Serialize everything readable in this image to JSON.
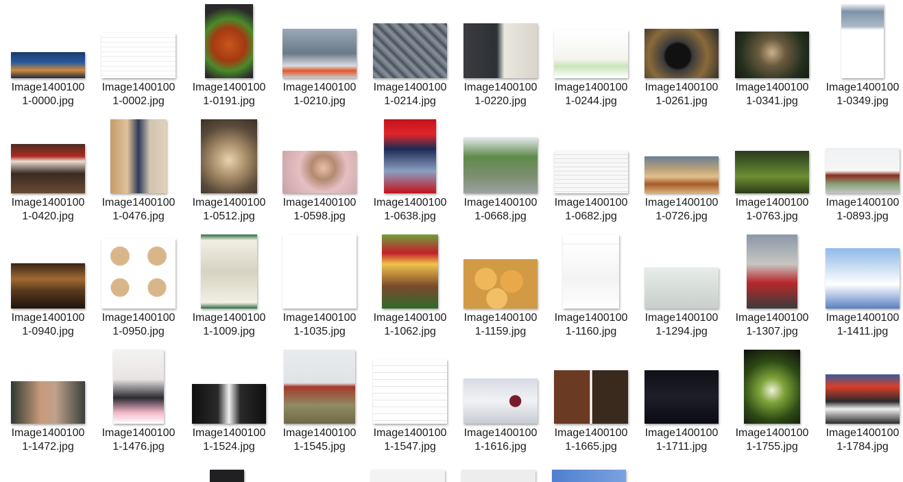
{
  "files": [
    {
      "line1": "Image1400100",
      "line2": "1-0000.jpg",
      "icon": "night-city-skyline-thumbnail",
      "bg": "linear-gradient(180deg,#1b3a6b 0%,#2a5a9c 40%,#d08a3a 70%,#1b2a44 100%)"
    },
    {
      "line1": "Image1400100",
      "line2": "1-0002.jpg",
      "icon": "document-table-thumbnail",
      "bg": "repeating-linear-gradient(180deg,#ffffff 0px,#ffffff 6px,#d8d8d8 7px)"
    },
    {
      "line1": "Image1400100",
      "line2": "1-0191.jpg",
      "icon": "stir-fry-dish-thumbnail",
      "bg": "radial-gradient(circle at 50% 55%,#c8551d 0%,#a33a12 35%,#4b8a2a 55%,#2a2a2a 80%)"
    },
    {
      "line1": "Image1400100",
      "line2": "1-0210.jpg",
      "icon": "snow-street-workers-thumbnail",
      "bg": "linear-gradient(180deg,#9aa9b8 0%,#6b7a88 50%,#d8dde2 75%,#e2572b 85%,#c9ced4 100%)"
    },
    {
      "line1": "Image1400100",
      "line2": "1-0214.jpg",
      "icon": "aerial-rooftops-thumbnail",
      "bg": "repeating-linear-gradient(45deg,#5b6470 0px,#8a939d 6px,#3e464f 12px)"
    },
    {
      "line1": "Image1400100",
      "line2": "1-0220.jpg",
      "icon": "man-at-door-thumbnail",
      "bg": "linear-gradient(90deg,#3b3b40 0%,#2c3136 45%,#e9e7df 55%,#d9d4c9 100%)"
    },
    {
      "line1": "Image1400100",
      "line2": "1-0244.jpg",
      "icon": "cartoon-sketch-thumbnail",
      "bg": "linear-gradient(180deg,#ffffff 0%,#f4f4ef 60%,#c9e6b8 75%,#ffffff 100%)"
    },
    {
      "line1": "Image1400100",
      "line2": "1-0261.jpg",
      "icon": "camera-lens-thumbnail",
      "bg": "radial-gradient(circle at 45% 55%,#111 0%,#111 25%,#3b3b3b 30%,#8a6a3a 60%,#2a2a2a 100%)"
    },
    {
      "line1": "Image1400100",
      "line2": "1-0341.jpg",
      "icon": "old-man-portrait-thumbnail",
      "bg": "radial-gradient(circle at 50% 45%,#c9b08a 0%,#6a5a3e 30%,#26301f 70%,#141a12 100%)"
    },
    {
      "line1": "Image1400100",
      "line2": "1-0349.jpg",
      "icon": "mobile-app-screenshot-thumbnail",
      "bg": "linear-gradient(180deg,#f2f2f2 0%,#7f93a8 10%,#a9b8c6 30%,#ffffff 35%,#ffffff 100%)"
    },
    {
      "line1": "Image1400100",
      "line2": "1-0420.jpg",
      "icon": "restaurant-facade-thumbnail",
      "bg": "linear-gradient(180deg,#4a2d22 0%,#b02a20 25%,#e9ddd2 35%,#3a2a22 60%,#6a4a33 100%)"
    },
    {
      "line1": "Image1400100",
      "line2": "1-0476.jpg",
      "icon": "street-fashion-man-thumbnail",
      "bg": "linear-gradient(90deg,#c59b6a 0%,#e1c29a 30%,#2d3a58 50%,#cfc4b1 70%,#e2d2bb 100%)"
    },
    {
      "line1": "Image1400100",
      "line2": "1-0512.jpg",
      "icon": "fantasy-illustration-thumbnail",
      "bg": "radial-gradient(circle at 50% 55%,#e7d3b0 0%,#a88d69 35%,#5a4a3a 70%,#3a2f25 100%)"
    },
    {
      "line1": "Image1400100",
      "line2": "1-0598.jpg",
      "icon": "woman-portrait-thumbnail",
      "bg": "radial-gradient(circle at 55% 40%,#e6c1a8 0%,#b38a71 25%,#e5bfc2 50%,#caa0a6 100%)"
    },
    {
      "line1": "Image1400100",
      "line2": "1-0638.jpg",
      "icon": "police-poster-thumbnail",
      "bg": "linear-gradient(180deg,#c3121a 0%,#e0262b 20%,#1b2a54 40%,#8aa0c2 70%,#c3121a 100%)"
    },
    {
      "line1": "Image1400100",
      "line2": "1-0668.jpg",
      "icon": "tree-parking-thumbnail",
      "bg": "linear-gradient(180deg,#e6ebef 0%,#5f8a4b 35%,#7c8f6f 70%,#9da1a3 100%)"
    },
    {
      "line1": "Image1400100",
      "line2": "1-0682.jpg",
      "icon": "spreadsheet-thumbnail",
      "bg": "repeating-linear-gradient(180deg,#f7f7f7 0px,#f7f7f7 5px,#c9c9c9 6px)"
    },
    {
      "line1": "Image1400100",
      "line2": "1-0726.jpg",
      "icon": "market-food-thumbnail",
      "bg": "linear-gradient(180deg,#6a7f96 0%,#b9a27a 35%,#e2c08b 55%,#a55a2b 75%,#d9b27a 100%)"
    },
    {
      "line1": "Image1400100",
      "line2": "1-0763.jpg",
      "icon": "football-referees-thumbnail",
      "bg": "linear-gradient(180deg,#2b3a1e 0%,#4d6a2a 35%,#6f8f33 60%,#2a3b18 100%)"
    },
    {
      "line1": "Image1400100",
      "line2": "1-0893.jpg",
      "icon": "modern-building-thumbnail",
      "bg": "linear-gradient(180deg,#eef1f3 0%,#f6f6f4 50%,#8a2d22 60%,#8aa27a 80%,#c3c8c4 100%)"
    },
    {
      "line1": "Image1400100",
      "line2": "1-0940.jpg",
      "icon": "bookstore-interior-thumbnail",
      "bg": "linear-gradient(180deg,#3b2516 0%,#a06a30 35%,#5a3a1e 60%,#1f140c 100%)"
    },
    {
      "line1": "Image1400100",
      "line2": "1-0950.jpg",
      "icon": "toilet-posture-diagram-thumbnail",
      "bg": "radial-gradient(circle at 25% 25%,#d9b68a 0 12%,transparent 13%),radial-gradient(circle at 75% 25%,#d9b68a 0 12%,transparent 13%),radial-gradient(circle at 25% 70%,#d9b68a 0 12%,transparent 13%),radial-gradient(circle at 75% 70%,#d9b68a 0 12%,transparent 13%),#ffffff"
    },
    {
      "line1": "Image1400100",
      "line2": "1-1009.jpg",
      "icon": "ink-drawing-poster-thumbnail",
      "bg": "linear-gradient(180deg,#2c6e3e 0%,#f1efe3 8%,#d7d2c1 50%,#f1efe3 92%,#2c6e3e 100%)"
    },
    {
      "line1": "Image1400100",
      "line2": "1-1035.jpg",
      "icon": "cat-line-drawing-thumbnail",
      "bg": "#ffffff"
    },
    {
      "line1": "Image1400100",
      "line2": "1-1062.jpg",
      "icon": "shop-stall-thumbnail",
      "bg": "linear-gradient(180deg,#6f9f3a 0%,#c3202a 25%,#f1c24a 40%,#7a4a2a 70%,#2f6a2a 100%)"
    },
    {
      "line1": "Image1400100",
      "line2": "1-1159.jpg",
      "icon": "sesame-balls-thumbnail",
      "bg": "radial-gradient(circle at 30% 40%,#f0b75a 0 18%,transparent 19%),radial-gradient(circle at 65% 45%,#e9a84a 0 20%,transparent 21%),radial-gradient(circle at 45% 80%,#f2bf66 0 18%,transparent 19%),#d39a45"
    },
    {
      "line1": "Image1400100",
      "line2": "1-1160.jpg",
      "icon": "worksheet-comic-thumbnail",
      "bg": "linear-gradient(180deg,#ffffff 0%,#ffffff 12%,#e8e8e8 13%,#ffffff 14%,#f3f3f3 60%,#ffffff 100%)"
    },
    {
      "line1": "Image1400100",
      "line2": "1-1294.jpg",
      "icon": "menu-paper-thumbnail",
      "bg": "linear-gradient(180deg,#e7ece9 0%,#d7ddd9 50%,#c9cfcb 100%)"
    },
    {
      "line1": "Image1400100",
      "line2": "1-1307.jpg",
      "icon": "girl-red-vest-thumbnail",
      "bg": "linear-gradient(180deg,#8a98a8 0%,#c7c6c2 40%,#b8282a 65%,#3b3b3b 100%)"
    },
    {
      "line1": "Image1400100",
      "line2": "1-1411.jpg",
      "icon": "anime-character-thumbnail",
      "bg": "linear-gradient(180deg,#8fb9e8 0%,#d9e8f6 40%,#ffffff 60%,#5a7fc2 100%)"
    },
    {
      "line1": "Image1400100",
      "line2": "1-1472.jpg",
      "icon": "man-in-car-thumbnail",
      "bg": "linear-gradient(90deg,#2f3a33 0%,#c79b7a 40%,#bfa18b 60%,#3a3f3b 100%)"
    },
    {
      "line1": "Image1400100",
      "line2": "1-1476.jpg",
      "icon": "girl-balloons-thumbnail",
      "bg": "linear-gradient(180deg,#f3f3f3 0%,#e9e4e2 40%,#2a2a33 65%,#f2b7c8 85%,#ffffff 100%)"
    },
    {
      "line1": "Image1400100",
      "line2": "1-1524.jpg",
      "icon": "snooker-players-thumbnail",
      "bg": "linear-gradient(90deg,#0f0f10 0%,#2a2a2a 35%,#f1f1f1 50%,#2a2a2a 65%,#0f0f10 100%)"
    },
    {
      "line1": "Image1400100",
      "line2": "1-1545.jpg",
      "icon": "gantry-crane-field-thumbnail",
      "bg": "linear-gradient(180deg,#e9ecee 0%,#e0e3e5 45%,#a43a2a 50%,#8f8b62 75%,#6f6a46 100%)"
    },
    {
      "line1": "Image1400100",
      "line2": "1-1547.jpg",
      "icon": "table-document-thumbnail",
      "bg": "repeating-linear-gradient(180deg,#ffffff 0px,#ffffff 9px,#c8c8c8 10px)"
    },
    {
      "line1": "Image1400100",
      "line2": "1-1616.jpg",
      "icon": "masked-face-art-thumbnail",
      "bg": "radial-gradient(circle at 70% 50%,#7a1a2a 0 10%,transparent 11%),linear-gradient(180deg,#d7dbe3 0%,#f1f2f5 50%,#c7cbd4 100%)"
    },
    {
      "line1": "Image1400100",
      "line2": "1-1665.jpg",
      "icon": "food-collage-thumbnail",
      "bg": "linear-gradient(90deg,#6b3a22 0%,#6b3a22 48%,#ffffff 49%,#ffffff 51%,#3a2a1e 52%,#3a2a1e 100%)"
    },
    {
      "line1": "Image1400100",
      "line2": "1-1711.jpg",
      "icon": "game-promo-thumbnail",
      "bg": "linear-gradient(180deg,#101018 0%,#1e1e2a 50%,#0a0a12 100%)"
    },
    {
      "line1": "Image1400100",
      "line2": "1-1755.jpg",
      "icon": "spider-plant-thumbnail",
      "bg": "radial-gradient(circle at 50% 55%,#eef3d8 0%,#7fa33a 25%,#2d4a14 60%,#0f0f0f 100%)"
    },
    {
      "line1": "Image1400100",
      "line2": "1-1784.jpg",
      "icon": "basketball-players-thumbnail",
      "bg": "linear-gradient(180deg,#3a5a9a 0%,#d8402a 25%,#2a2a2a 55%,#f0f0f0 70%,#2a2a2a 100%)"
    }
  ],
  "partial_row": [
    {
      "icon": "dark-screen-thumbnail-partial",
      "bg": "#202022"
    },
    {
      "icon": "document-thumbnail-partial",
      "bg": "#f3f3f3"
    },
    {
      "icon": "white-object-thumbnail-partial",
      "bg": "#ededed"
    },
    {
      "icon": "sky-thumbnail-partial",
      "bg": "linear-gradient(90deg,#4f7fd0 0%,#7aa2e0 100%)"
    }
  ]
}
